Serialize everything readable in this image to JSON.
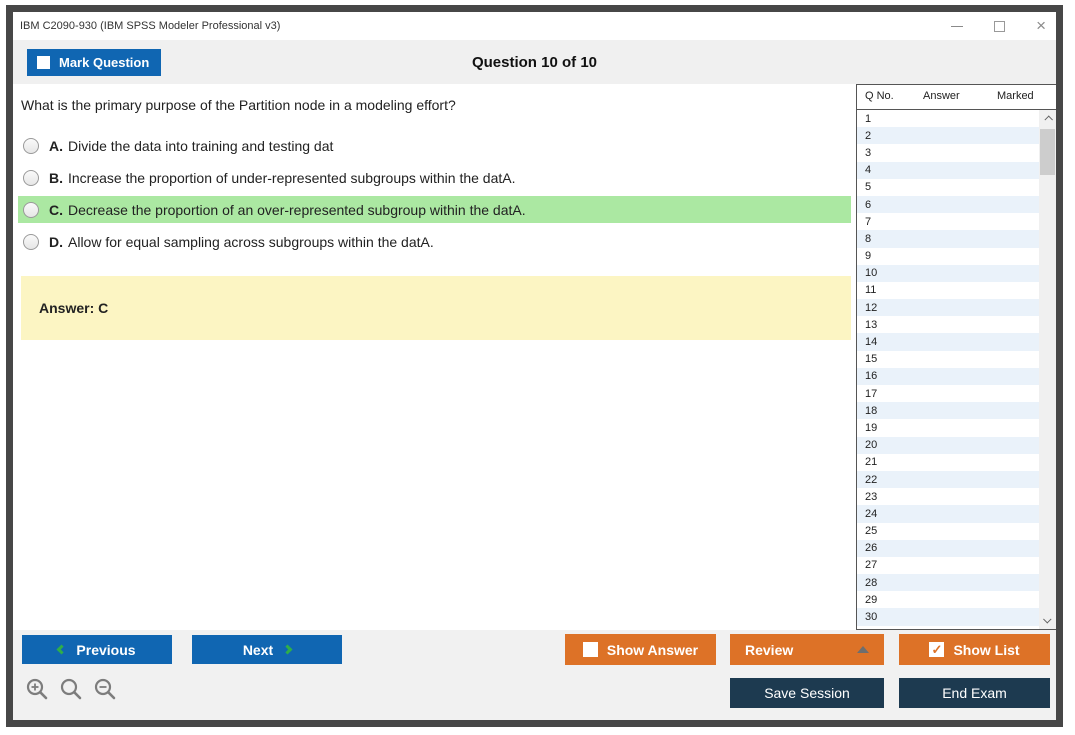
{
  "window": {
    "title": "IBM C2090-930 (IBM SPSS Modeler Professional v3)"
  },
  "header": {
    "mark_question_label": "Mark Question",
    "question_counter": "Question 10 of 10"
  },
  "question": {
    "text": "What is the primary purpose of the Partition node in a modeling effort?",
    "options": [
      {
        "letter": "A.",
        "text": "Divide the data into training and testing dat",
        "highlighted": false
      },
      {
        "letter": "B.",
        "text": "Increase the proportion of under-represented subgroups within the datA.",
        "highlighted": false
      },
      {
        "letter": "C.",
        "text": "Decrease the proportion of an over-represented subgroup within the datA.",
        "highlighted": true
      },
      {
        "letter": "D.",
        "text": "Allow for equal sampling across subgroups within the datA.",
        "highlighted": false
      }
    ],
    "answer_label": "Answer: C"
  },
  "question_list": {
    "columns": [
      "Q No.",
      "Answer",
      "Marked"
    ],
    "rows": [
      "1",
      "2",
      "3",
      "4",
      "5",
      "6",
      "7",
      "8",
      "9",
      "10",
      "11",
      "12",
      "13",
      "14",
      "15",
      "16",
      "17",
      "18",
      "19",
      "20",
      "21",
      "22",
      "23",
      "24",
      "25",
      "26",
      "27",
      "28",
      "29",
      "30"
    ]
  },
  "footer": {
    "previous_label": "Previous",
    "next_label": "Next",
    "show_answer_label": "Show Answer",
    "review_label": "Review",
    "show_list_label": "Show List",
    "save_session_label": "Save Session",
    "end_exam_label": "End Exam",
    "show_list_checked": "✓"
  },
  "colors": {
    "accent_blue": "#1066b2",
    "accent_orange": "#dd7227",
    "accent_navy": "#1d3a50",
    "highlight_green": "#abe8a2",
    "answer_yellow": "#fcf5c3",
    "row_stripe_blue": "#eaf2fa",
    "chevron_green": "#2fae49",
    "strip_gray": "#f0f0f0",
    "frame_border": "#474747"
  }
}
